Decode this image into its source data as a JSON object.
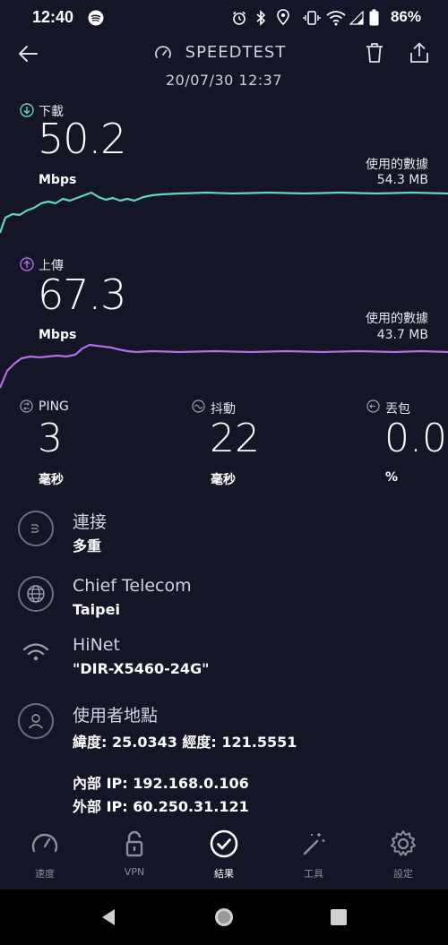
{
  "status_bar": {
    "time": "12:40",
    "battery": "86%"
  },
  "header": {
    "title": "SPEEDTEST",
    "datetime": "20/07/30 12:37"
  },
  "download": {
    "label": "下載",
    "value": "50.2",
    "unit": "Mbps",
    "data_used_label": "使用的數據",
    "data_used": "54.3 MB",
    "color": "#5fd6c9"
  },
  "upload": {
    "label": "上傳",
    "value": "67.3",
    "unit": "Mbps",
    "data_used_label": "使用的數據",
    "data_used": "43.7 MB",
    "color": "#b56ce4"
  },
  "ping": {
    "label": "PING",
    "value": "3",
    "unit": "毫秒"
  },
  "jitter": {
    "label": "抖動",
    "value": "22",
    "unit": "毫秒"
  },
  "loss": {
    "label": "丟包",
    "value": "0.0",
    "unit": "%"
  },
  "connection": {
    "title": "連接",
    "value": "多重"
  },
  "provider": {
    "title": "Chief Telecom",
    "value": "Taipei"
  },
  "network": {
    "title": "HiNet",
    "value": "\"DIR-X5460-24G\""
  },
  "location": {
    "title": "使用者地點",
    "value": "緯度: 25.0343 經度: 121.5551"
  },
  "ips": {
    "internal": "內部 IP: 192.168.0.106",
    "external": "外部 IP: 60.250.31.121"
  },
  "nav": [
    {
      "label": "速度",
      "icon": "gauge-icon"
    },
    {
      "label": "VPN",
      "icon": "lock-icon"
    },
    {
      "label": "結果",
      "icon": "check-circle-icon"
    },
    {
      "label": "工具",
      "icon": "magic-wand-icon"
    },
    {
      "label": "設定",
      "icon": "gear-icon"
    }
  ]
}
